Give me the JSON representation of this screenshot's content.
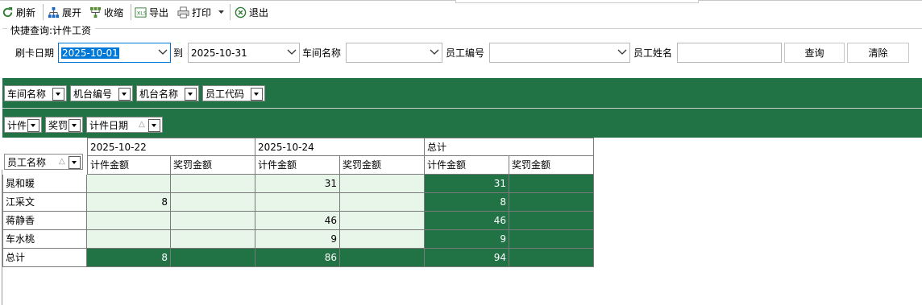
{
  "toolbar": {
    "refresh": "刷新",
    "expand": "展开",
    "collapse": "收缩",
    "export": "导出",
    "print": "打印",
    "exit": "退出"
  },
  "query": {
    "group_title": "快捷查询:计件工资",
    "date_label": "刷卡日期",
    "date_from": "2025-10-01",
    "to_label": "到",
    "date_to": "2025-10-31",
    "workshop_label": "车间名称",
    "workshop_value": "",
    "emp_no_label": "员工编号",
    "emp_no_value": "",
    "emp_name_label": "员工姓名",
    "emp_name_value": "",
    "query_button": "查询",
    "clear_button": "清除"
  },
  "pivot": {
    "filter_fields": [
      "车间名称",
      "机台编号",
      "机台名称",
      "员工代码"
    ],
    "data_fields": [
      "计件",
      "奖罚"
    ],
    "column_field": "计件日期",
    "row_field": "员工名称",
    "columns": [
      "2025-10-22",
      "2025-10-24",
      "总计"
    ],
    "measures": [
      "计件金额",
      "奖罚金额"
    ],
    "rows": [
      {
        "name": "晁和暖",
        "values": [
          "",
          "",
          "31",
          "",
          "31",
          ""
        ]
      },
      {
        "name": "江采文",
        "values": [
          "8",
          "",
          "",
          "",
          "8",
          ""
        ]
      },
      {
        "name": "蒋静香",
        "values": [
          "",
          "",
          "46",
          "",
          "46",
          ""
        ]
      },
      {
        "name": "车水桃",
        "values": [
          "",
          "",
          "9",
          "",
          "9",
          ""
        ]
      }
    ],
    "total_row": {
      "name": "总计",
      "values": [
        "8",
        "",
        "86",
        "",
        "94",
        ""
      ]
    }
  },
  "colors": {
    "accent_green": "#217346",
    "data_bg": "#e8f5e9"
  }
}
